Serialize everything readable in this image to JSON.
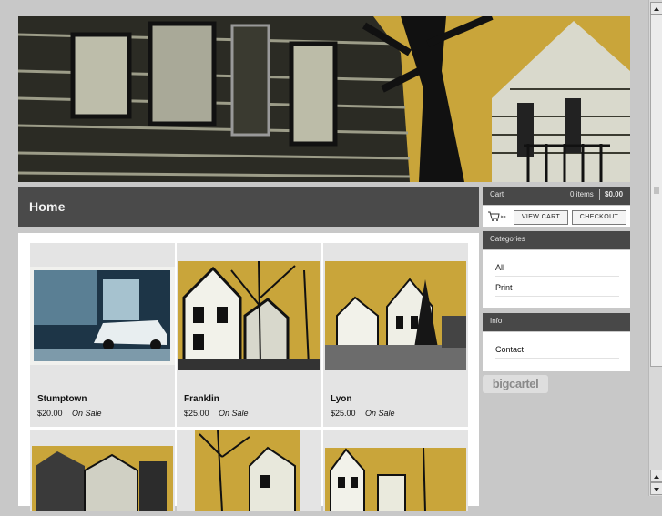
{
  "header": {
    "banner_name": "woodcut-houses-banner"
  },
  "page": {
    "title": "Home"
  },
  "products": [
    {
      "name": "Stumptown",
      "price": "$20.00",
      "badge": "On Sale"
    },
    {
      "name": "Franklin",
      "price": "$25.00",
      "badge": "On Sale"
    },
    {
      "name": "Lyon",
      "price": "$25.00",
      "badge": "On Sale"
    }
  ],
  "cart": {
    "heading": "Cart",
    "count": "0 items",
    "total": "$0.00",
    "view_label": "VIEW CART",
    "checkout_label": "CHECKOUT",
    "icon": "cart-icon"
  },
  "categories": {
    "heading": "Categories",
    "items": [
      "All",
      "Print"
    ]
  },
  "info": {
    "heading": "Info",
    "items": [
      "Contact"
    ]
  },
  "footer": {
    "badge": "bigcartel"
  },
  "colors": {
    "accent": "#c9a53a",
    "dark_bar": "#4a4a4a",
    "page_bg": "#c8c8c8"
  }
}
